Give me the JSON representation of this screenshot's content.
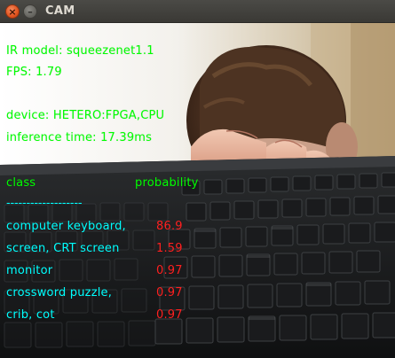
{
  "window": {
    "title": "CAM",
    "close_glyph": "×",
    "minimize_glyph": "–"
  },
  "overlay": {
    "model": "IR model: squeezenet1.1",
    "fps": "FPS: 1.79",
    "device": "device: HETERO:FPGA,CPU",
    "inference": "inference time: 17.39ms",
    "header_class": "class",
    "header_probability": "probability",
    "separator": "-------------------",
    "results": [
      {
        "label": "computer keyboard,",
        "prob": "86.9"
      },
      {
        "label": "screen, CRT screen",
        "prob": "1.59"
      },
      {
        "label": "monitor",
        "prob": "0.97"
      },
      {
        "label": "crossword puzzle,",
        "prob": "0.97"
      },
      {
        "label": "crib, cot",
        "prob": "0.97"
      }
    ]
  },
  "colors": {
    "info_text": "#00ff00",
    "label_text": "#00ffff",
    "prob_text": "#ff2020",
    "titlebar": "#3c3b37"
  },
  "icons": {
    "close": "close-icon",
    "minimize": "minimize-icon"
  }
}
